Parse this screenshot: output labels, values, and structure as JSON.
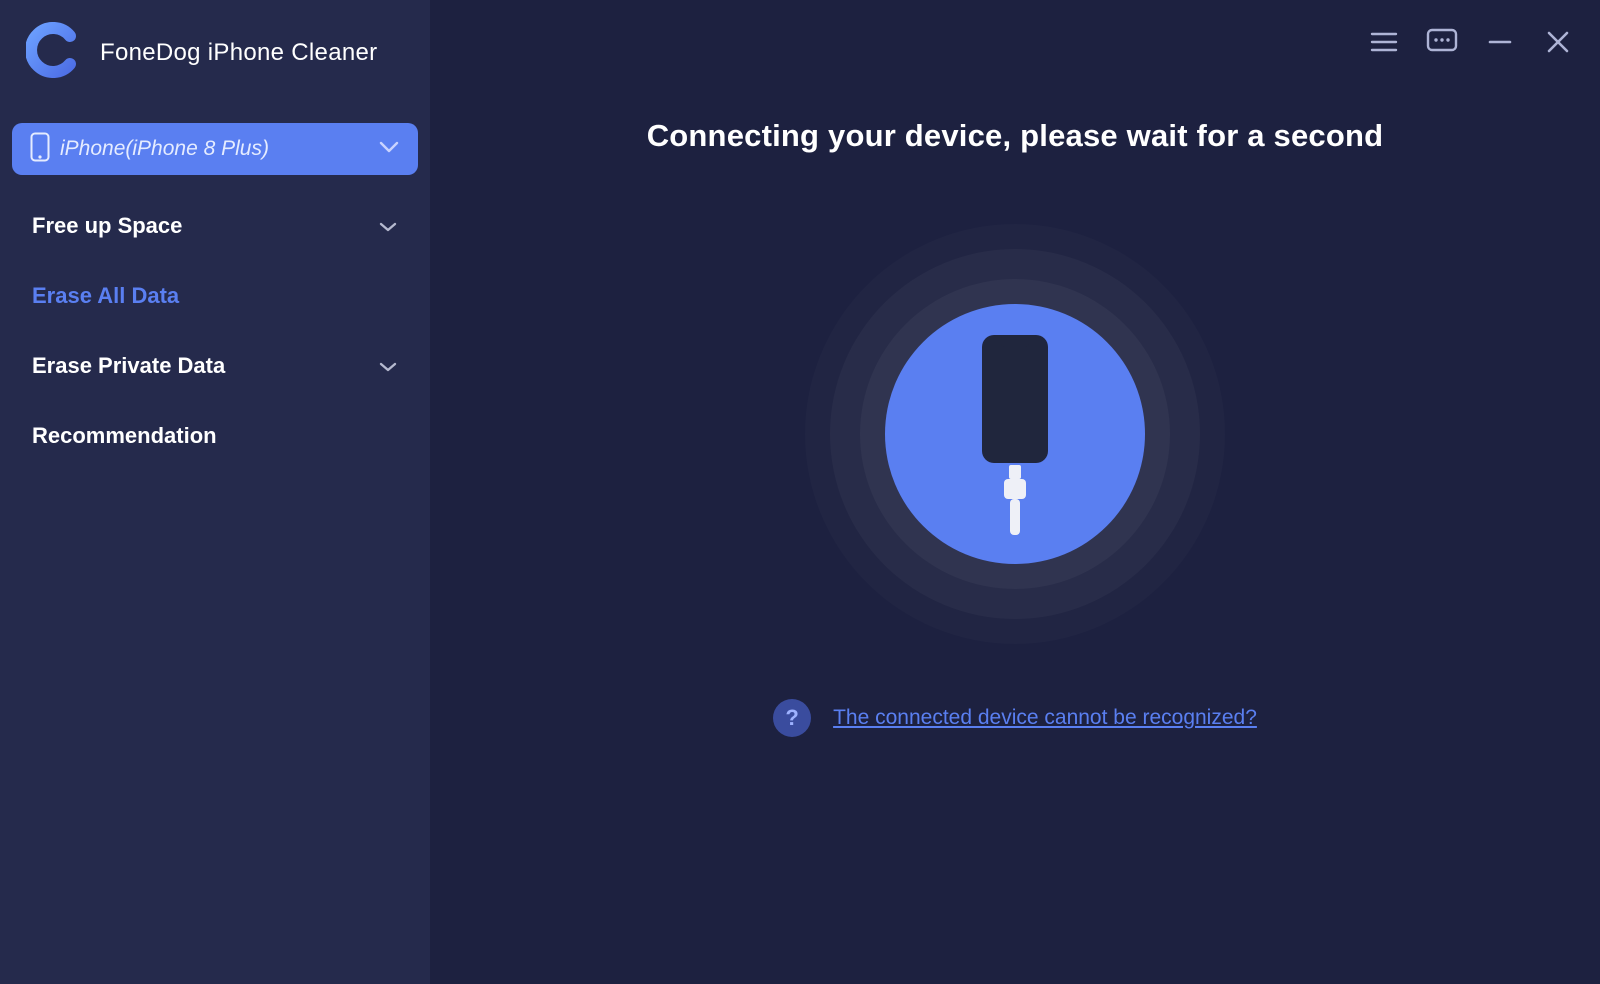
{
  "app": {
    "title": "FoneDog iPhone Cleaner"
  },
  "device": {
    "label": "iPhone(iPhone 8 Plus)"
  },
  "sidebar": {
    "items": [
      {
        "label": "Free up Space",
        "expandable": true,
        "active": false
      },
      {
        "label": "Erase All Data",
        "expandable": false,
        "active": true
      },
      {
        "label": "Erase Private Data",
        "expandable": true,
        "active": false
      },
      {
        "label": "Recommendation",
        "expandable": false,
        "active": false
      }
    ]
  },
  "main": {
    "headline": "Connecting your device, please wait for a second",
    "help_link": "The connected device cannot be recognized?",
    "help_badge": "?"
  },
  "colors": {
    "accent": "#5a7ff1",
    "bg": "#1d2140",
    "sidebar": "#252a4c"
  }
}
